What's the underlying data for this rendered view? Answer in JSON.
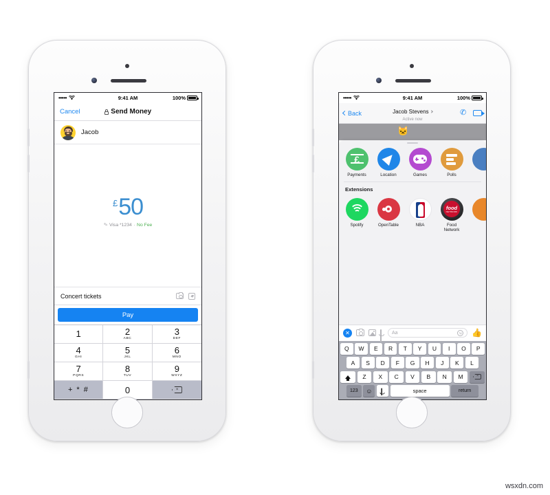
{
  "watermark": "wsxdn.com",
  "phone_left": {
    "status_bar": {
      "signal": "•••••",
      "wifi_icon": "wifi-icon",
      "time": "9:41 AM",
      "battery_pct": "100%"
    },
    "nav": {
      "cancel_label": "Cancel",
      "title": "Send Money",
      "lock_icon": "lock-icon"
    },
    "contact": {
      "name": "Jacob",
      "avatar_icon": "avatar"
    },
    "amount": {
      "currency": "£",
      "value": "50",
      "edit_icon": "pencil-icon",
      "card": "Visa *1234",
      "separator": "·",
      "fee": "No Fee"
    },
    "memo": {
      "text": "Concert tickets",
      "camera_icon": "camera-icon",
      "sticker_icon": "sticker-icon"
    },
    "pay_button": {
      "label": "Pay"
    },
    "keypad": [
      {
        "num": "1",
        "sub": ""
      },
      {
        "num": "2",
        "sub": "ABC"
      },
      {
        "num": "3",
        "sub": "DEF"
      },
      {
        "num": "4",
        "sub": "GHI"
      },
      {
        "num": "5",
        "sub": "JKL"
      },
      {
        "num": "6",
        "sub": "MNO"
      },
      {
        "num": "7",
        "sub": "PQRS"
      },
      {
        "num": "8",
        "sub": "TUV"
      },
      {
        "num": "9",
        "sub": "WXYZ"
      },
      {
        "num": "+ * #",
        "sub": ""
      },
      {
        "num": "0",
        "sub": ""
      },
      {
        "num": "",
        "sub": ""
      }
    ],
    "backspace_icon": "backspace-icon"
  },
  "phone_right": {
    "status_bar": {
      "signal": "•••••",
      "wifi_icon": "wifi-icon",
      "time": "9:41 AM",
      "battery_pct": "100%"
    },
    "nav": {
      "back_label": "Back",
      "contact_name": "Jacob Stevens",
      "status": "Active now",
      "call_icon": "phone-icon",
      "video_icon": "video-camera-icon"
    },
    "apps_row": [
      {
        "label": "Payments",
        "color": "#4ec16e",
        "icon": "pound-note-icon"
      },
      {
        "label": "Location",
        "color": "#1f86e8",
        "icon": "paper-plane-icon"
      },
      {
        "label": "Games",
        "color": "#b44ad0",
        "icon": "game-controller-icon"
      },
      {
        "label": "Polls",
        "color": "#e09b3d",
        "icon": "bar-chart-icon"
      },
      {
        "label": "",
        "color": "#4a7fc1",
        "icon": "partial-app-icon"
      }
    ],
    "extensions_title": "Extensions",
    "extensions_row": [
      {
        "label": "Spotify",
        "color": "#1ed760",
        "icon": "spotify-icon"
      },
      {
        "label": "OpenTable",
        "color": "#da3743",
        "icon": "opentable-icon"
      },
      {
        "label": "NBA",
        "color": "#ffffff",
        "icon": "nba-icon"
      },
      {
        "label": "Food Network",
        "color": "#c8102e",
        "icon": "food-network-icon",
        "word1": "food",
        "word2": "NETWORK"
      },
      {
        "label": "",
        "color": "#e8872a",
        "icon": "partial-extension-icon"
      }
    ],
    "composer": {
      "close_icon": "close-circle-icon",
      "camera_icon": "camera-icon",
      "photos_icon": "photo-library-icon",
      "mic_icon": "microphone-icon",
      "placeholder": "Aa",
      "emoji_icon": "smiley-icon",
      "thumbs_up_icon": "thumbs-up-icon"
    },
    "keyboard": {
      "row1": [
        "Q",
        "W",
        "E",
        "R",
        "T",
        "Y",
        "U",
        "I",
        "O",
        "P"
      ],
      "row2": [
        "A",
        "S",
        "D",
        "F",
        "G",
        "H",
        "J",
        "K",
        "L"
      ],
      "row3": [
        "Z",
        "X",
        "C",
        "V",
        "B",
        "N",
        "M"
      ],
      "shift_icon": "shift-icon",
      "delete_icon": "backspace-icon",
      "numbers_label": "123",
      "emoji_label": "☺",
      "mic_icon": "microphone-icon",
      "space_label": "space",
      "return_label": "return"
    }
  }
}
